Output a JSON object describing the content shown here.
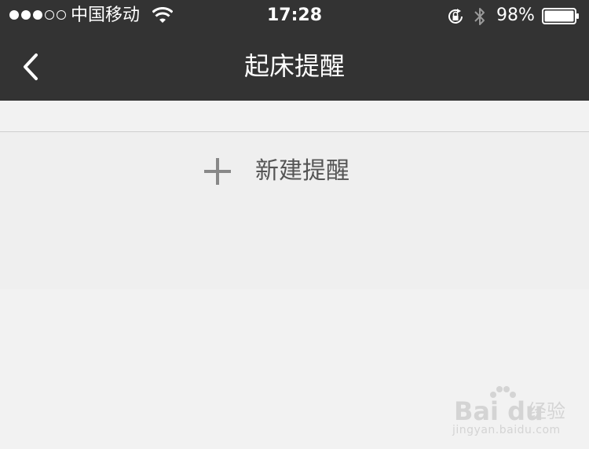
{
  "status_bar": {
    "signal_dots": [
      true,
      true,
      true,
      false,
      false
    ],
    "carrier": "中国移动",
    "time": "17:28",
    "battery_percent": "98%",
    "battery_level": 0.98,
    "icons": [
      "wifi-icon",
      "rotation-lock-icon",
      "bluetooth-icon",
      "battery-icon"
    ]
  },
  "nav": {
    "title": "起床提醒",
    "back_icon": "chevron-left-icon"
  },
  "list": {
    "new_reminder_label": "新建提醒",
    "new_reminder_icon": "plus-icon"
  },
  "watermark": {
    "logo": "Bai du",
    "label": "经验",
    "url": "jingyan.baidu.com"
  },
  "colors": {
    "topbar": "#333333",
    "background": "#f2f2f2",
    "divider": "#cfcfcf",
    "label": "#555555"
  }
}
